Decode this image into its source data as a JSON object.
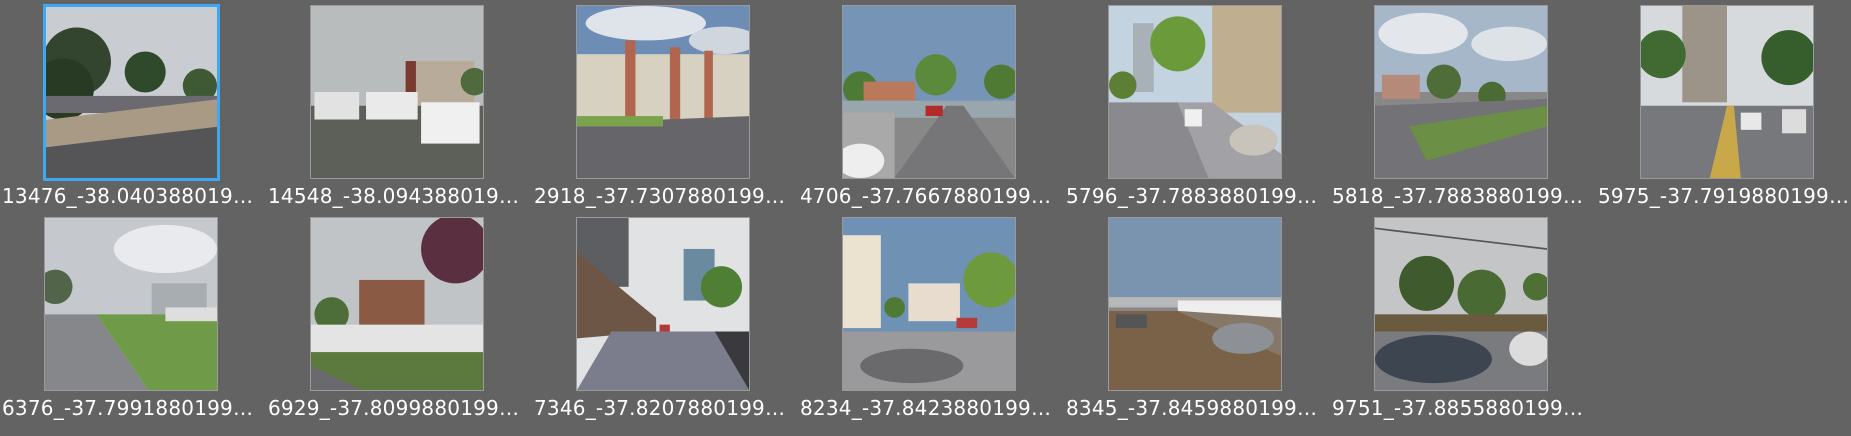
{
  "gallery": {
    "items": [
      {
        "label": "13476_-38.0403880199...",
        "thumbnail": "street-photo-thumbnail",
        "selected": true
      },
      {
        "label": "14548_-38.0943880199...",
        "thumbnail": "street-photo-thumbnail",
        "selected": false
      },
      {
        "label": "2918_-37.73078801999...",
        "thumbnail": "street-photo-thumbnail",
        "selected": false
      },
      {
        "label": "4706_-37.76678801999...",
        "thumbnail": "street-photo-thumbnail",
        "selected": false
      },
      {
        "label": "5796_-37.78838801999...",
        "thumbnail": "street-photo-thumbnail",
        "selected": false
      },
      {
        "label": "5818_-37.78838801999...",
        "thumbnail": "street-photo-thumbnail",
        "selected": false
      },
      {
        "label": "5975_-37.79198801999...",
        "thumbnail": "street-photo-thumbnail",
        "selected": false
      },
      {
        "label": "6376_-37.79918801999...",
        "thumbnail": "street-photo-thumbnail",
        "selected": false
      },
      {
        "label": "6929_-37.80998801999...",
        "thumbnail": "street-photo-thumbnail",
        "selected": false
      },
      {
        "label": "7346_-37.82078801999...",
        "thumbnail": "street-photo-thumbnail",
        "selected": false
      },
      {
        "label": "8234_-37.84238801999...",
        "thumbnail": "street-photo-thumbnail",
        "selected": false
      },
      {
        "label": "8345_-37.84598801999...",
        "thumbnail": "street-photo-thumbnail",
        "selected": false
      },
      {
        "label": "9751_-37.88558801999...",
        "thumbnail": "street-photo-thumbnail",
        "selected": false
      }
    ]
  },
  "colors": {
    "background": "#636363",
    "selection_border": "#3ea8f0",
    "caption_text": "#ffffff"
  }
}
